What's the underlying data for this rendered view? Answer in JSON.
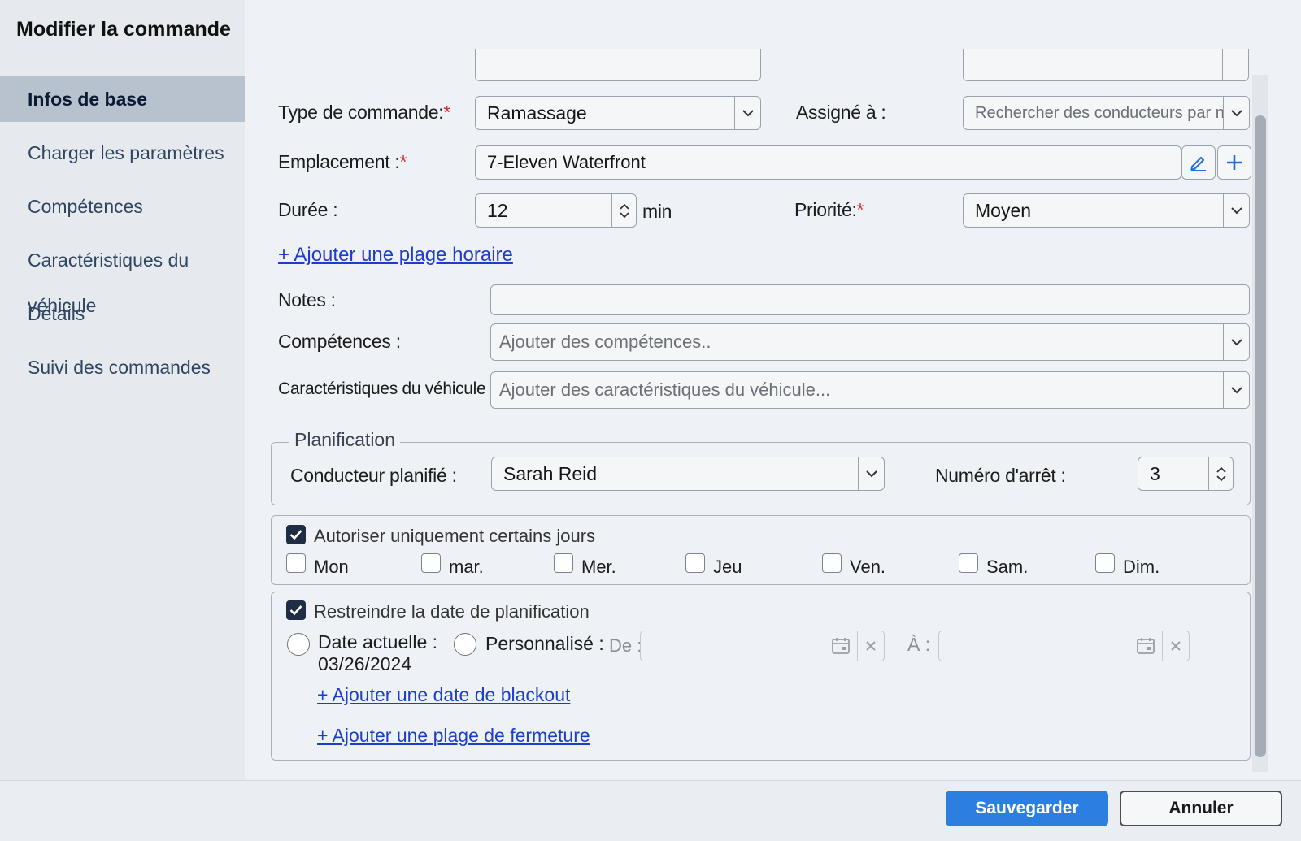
{
  "dialog": {
    "title": "Modifier la commande"
  },
  "sidebar": {
    "items": [
      {
        "label": "Infos de base",
        "active": true
      },
      {
        "label": "Charger les paramètres"
      },
      {
        "label": "Compétences"
      },
      {
        "label": "Caractéristiques du véhicule"
      },
      {
        "label": "Détails"
      },
      {
        "label": "Suivi des commandes"
      }
    ]
  },
  "form": {
    "order_type": {
      "label": "Type de commande:",
      "value": "Ramassage"
    },
    "assigned_to": {
      "label": "Assigné à :",
      "placeholder": "Rechercher des conducteurs par nom ou"
    },
    "location": {
      "label": "Emplacement :",
      "value": "7-Eleven Waterfront"
    },
    "duration": {
      "label": "Durée :",
      "value": "12",
      "unit": "min"
    },
    "priority": {
      "label": "Priorité:",
      "value": "Moyen"
    },
    "add_time_window": "+ Ajouter une plage horaire",
    "notes": {
      "label": "Notes :",
      "value": ""
    },
    "skills": {
      "label": "Compétences :",
      "placeholder": "Ajouter des compétences.."
    },
    "vehicle_features": {
      "label": "Caractéristiques du véhicule :",
      "placeholder": "Ajouter des caractéristiques du véhicule..."
    },
    "required_mark": "*"
  },
  "planning": {
    "legend": "Planification",
    "driver": {
      "label": "Conducteur planifié :",
      "value": "Sarah Reid"
    },
    "stop_number": {
      "label": "Numéro d'arrêt :",
      "value": "3"
    }
  },
  "days": {
    "label": "Autoriser uniquement certains jours",
    "checked": true,
    "items": [
      {
        "label": "Mon",
        "checked": false
      },
      {
        "label": "mar.",
        "checked": false
      },
      {
        "label": "Mer.",
        "checked": false
      },
      {
        "label": "Jeu",
        "checked": false
      },
      {
        "label": "Ven.",
        "checked": false
      },
      {
        "label": "Sam.",
        "checked": false
      },
      {
        "label": "Dim.",
        "checked": false
      }
    ]
  },
  "restrict_date": {
    "label": "Restreindre la date de planification",
    "checked": true,
    "current_date_label": "Date actuelle :",
    "current_date_value": "03/26/2024",
    "custom_label": "Personnalisé :",
    "from_label": "De :",
    "to_label": "À :",
    "add_blackout": "+ Ajouter une date de blackout",
    "add_closure": "+ Ajouter une plage de fermeture"
  },
  "footer": {
    "save": "Sauvegarder",
    "cancel": "Annuler"
  },
  "colors": {
    "primary": "#2a7fe0",
    "link": "#1d3ec9",
    "required": "#d12c2c",
    "active_nav": "#b8c2cf"
  }
}
